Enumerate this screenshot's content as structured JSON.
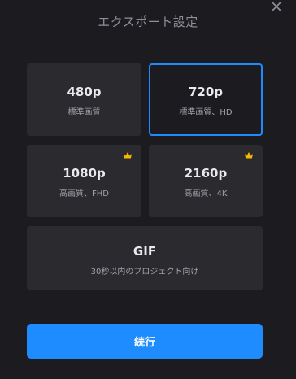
{
  "dialog": {
    "title": "エクスポート設定",
    "close_icon": "close-icon"
  },
  "options": [
    {
      "resolution": "480p",
      "description": "標準画質",
      "selected": false,
      "premium": false
    },
    {
      "resolution": "720p",
      "description": "標準画質、HD",
      "selected": true,
      "premium": false
    },
    {
      "resolution": "1080p",
      "description": "高画質、FHD",
      "selected": false,
      "premium": true
    },
    {
      "resolution": "2160p",
      "description": "高画質、4K",
      "selected": false,
      "premium": true
    },
    {
      "resolution": "GIF",
      "description": "30秒以内のプロジェクト向け",
      "selected": false,
      "premium": false
    }
  ],
  "footer": {
    "continue_label": "続行"
  },
  "colors": {
    "background": "#1c1c20",
    "card": "#2a2a2f",
    "accent": "#1e8bff",
    "crown": "#f5b800"
  }
}
